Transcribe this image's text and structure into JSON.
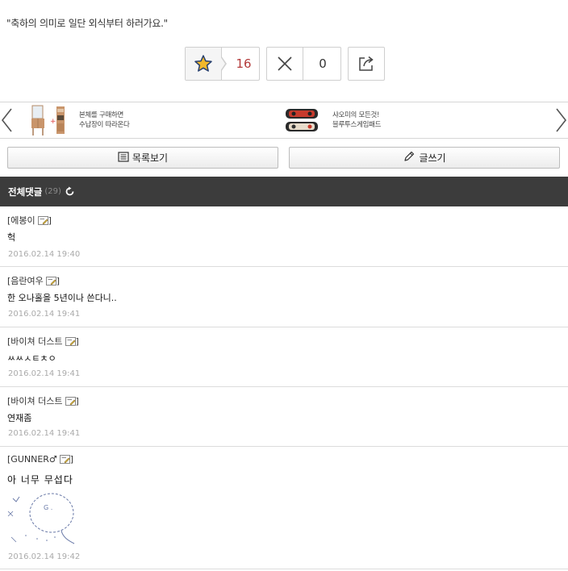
{
  "post": {
    "quote": "\"축하의 의미로 일단 외식부터 하러가요.\""
  },
  "votes": {
    "recommend_count": "16",
    "oppose_count": "0",
    "recommend_icon": "star-icon",
    "oppose_icon": "close-icon",
    "share_icon": "share-icon",
    "recommend_color": "#b33a3a"
  },
  "banner": {
    "items": [
      {
        "line1": "본체를 구매하면",
        "line2": "수납장이 따라온다",
        "icon": "furniture-image"
      },
      {
        "line1": "샤오미의 모든것!",
        "line2": "블루투스게임패드",
        "icon": "gamepad-image"
      }
    ]
  },
  "actions": {
    "list_label": "목록보기",
    "write_label": "글쓰기"
  },
  "comments_header": {
    "title": "전체댓글",
    "count": "(29)",
    "bg_color": "#3c3c3c"
  },
  "comments": [
    {
      "author": "[에봉이",
      "close": "]",
      "text": "헉",
      "date": "2016.02.14 19:40"
    },
    {
      "author": "[음란여우",
      "close": "]",
      "text": "한 오나홀을 5년이나 쓴다니..",
      "date": "2016.02.14 19:41"
    },
    {
      "author": "[바이쳐 더스트",
      "close": "]",
      "text": "ㅆㅆㅅㅌㅊㅇ",
      "date": "2016.02.14 19:41"
    },
    {
      "author": "[바이쳐 더스트",
      "close": "]",
      "text": "연재좀",
      "date": "2016.02.14 19:41"
    },
    {
      "author": "[GUNNER♂",
      "close": "]",
      "text": "아 너무 무섭다",
      "date": "2016.02.14 19:42"
    }
  ]
}
